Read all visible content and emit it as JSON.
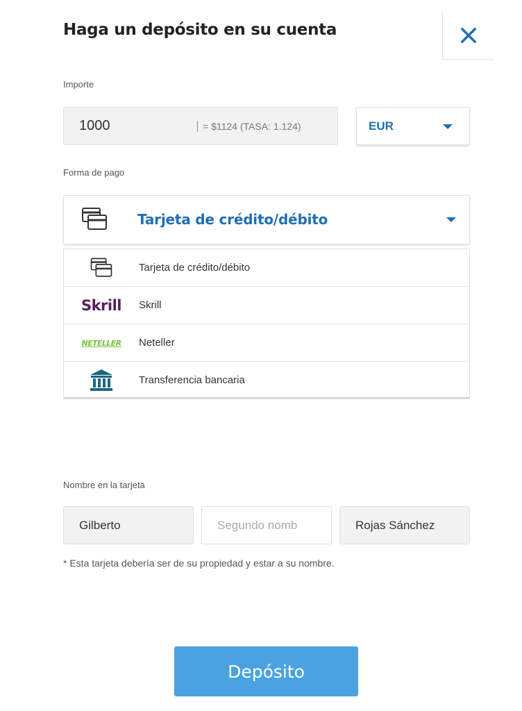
{
  "header": {
    "title": "Haga un depósito en su cuenta",
    "close_icon": "close-icon"
  },
  "amount": {
    "label": "Importe",
    "value": "1000",
    "conversion": "= $1124  (TASA: 1.124)"
  },
  "currency": {
    "selected": "EUR",
    "icon": "chevron-down-icon"
  },
  "payment_method": {
    "label": "Forma de pago",
    "selected": "Tarjeta de crédito/débito",
    "selected_icon": "credit-card-icon",
    "options": [
      {
        "label": "Tarjeta de crédito/débito",
        "icon": "credit-card-icon"
      },
      {
        "label": "Skrill",
        "logo_text": "Skrill",
        "icon": "skrill-logo"
      },
      {
        "label": "Neteller",
        "logo_text": "NETELLER",
        "icon": "neteller-logo"
      },
      {
        "label": "Transferencia bancaria",
        "icon": "bank-icon"
      }
    ]
  },
  "card_name": {
    "label": "Nombre en la tarjeta",
    "first_name": "Gilberto",
    "middle_name_placeholder": "Segundo nomb",
    "last_name": "Rojas Sánchez",
    "note": "* Esta tarjeta debería ser de su propiedad y estar a su nombre."
  },
  "submit": {
    "label": "Depósito"
  },
  "colors": {
    "accent": "#1f6fb3",
    "button": "#4aa3e0",
    "skrill": "#5a1e5c",
    "neteller": "#7ac142",
    "bank": "#1b6680"
  }
}
